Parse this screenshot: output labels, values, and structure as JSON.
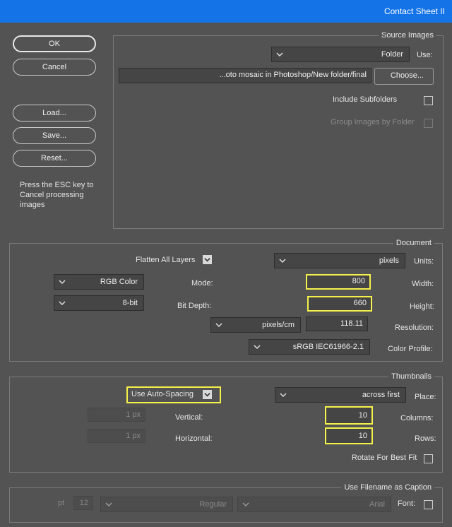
{
  "window": {
    "title": "Contact Sheet II"
  },
  "buttons": {
    "ok": "OK",
    "cancel": "Cancel",
    "load": "Load...",
    "save": "Save...",
    "reset": "Reset...",
    "note": "Press the ESC key to Cancel processing images"
  },
  "source": {
    "legend": "Source Images",
    "use_label": "Use:",
    "use_value": "Folder",
    "choose": "Choose...",
    "path": "...oto mosaic in Photoshop/New folder/final",
    "include_subfolders": "Include Subfolders",
    "group_by_folder": "Group Images by Folder"
  },
  "document": {
    "legend": "Document",
    "units_label": "Units:",
    "units_value": "pixels",
    "flatten": "Flatten All Layers",
    "width_label": "Width:",
    "width_value": "800",
    "height_label": "Height:",
    "height_value": "660",
    "resolution_label": "Resolution:",
    "resolution_value": "118.11",
    "resolution_unit": "pixels/cm",
    "mode_label": "Mode:",
    "mode_value": "RGB Color",
    "depth_label": "Bit Depth:",
    "depth_value": "8-bit",
    "profile_label": "Color Profile:",
    "profile_value": "sRGB IEC61966-2.1"
  },
  "thumbnails": {
    "legend": "Thumbnails",
    "place_label": "Place:",
    "place_value": "across first",
    "auto_spacing": "Use Auto-Spacing",
    "columns_label": "Columns:",
    "columns_value": "10",
    "rows_label": "Rows:",
    "rows_value": "10",
    "vertical_label": "Vertical:",
    "vertical_value": "1 px",
    "horizontal_label": "Horizontal:",
    "horizontal_value": "1 px",
    "rotate": "Rotate For Best Fit"
  },
  "caption": {
    "legend": "Use Filename as Caption",
    "font_label": "Font:",
    "font_value": "Arial",
    "style_value": "Regular",
    "size_value": "12",
    "size_unit": "pt"
  }
}
